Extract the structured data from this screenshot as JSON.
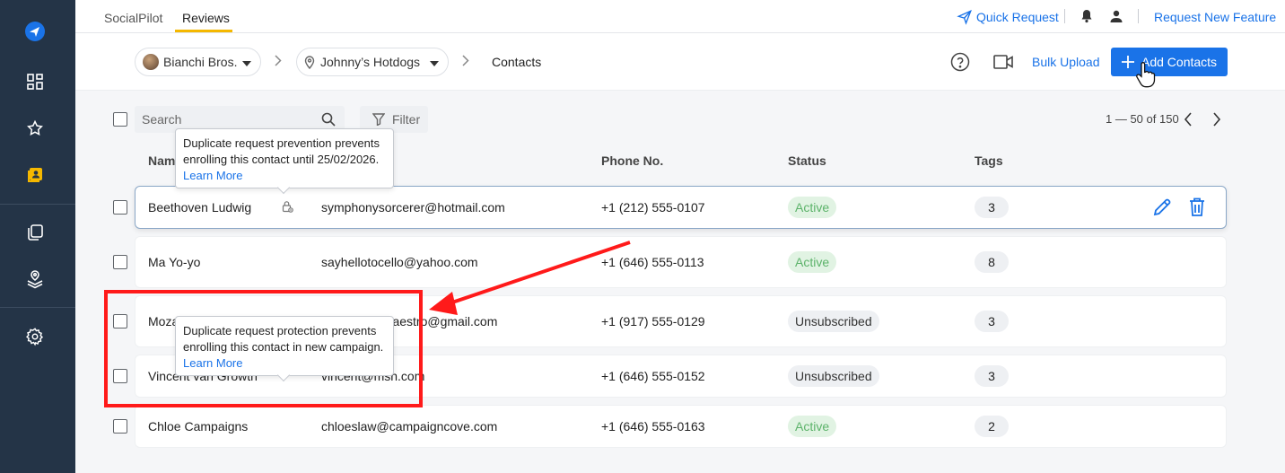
{
  "colors": {
    "accent": "#1a73e8",
    "sidebar": "#243447",
    "tab_underline": "#f5b800",
    "active_badge": "#5cb36a",
    "annotation": "#ff1a1a"
  },
  "sidebar": {
    "items": [
      {
        "icon": "paper-plane-icon"
      },
      {
        "icon": "dashboard-icon"
      },
      {
        "icon": "star-icon"
      },
      {
        "icon": "contacts-icon"
      },
      {
        "icon": "copy-icon"
      },
      {
        "icon": "location-layers-icon"
      },
      {
        "icon": "gear-icon"
      }
    ]
  },
  "topbar": {
    "tabs": [
      {
        "label": "SocialPilot"
      },
      {
        "label": "Reviews"
      }
    ],
    "quick_request": "Quick Request",
    "request_feature": "Request New Feature"
  },
  "breadcrumb": {
    "account": "Bianchi Bros.",
    "location": "Johnny’s Hotdogs",
    "current": "Contacts"
  },
  "toolbar": {
    "bulk_upload": "Bulk Upload",
    "add_contacts": "Add Contacts"
  },
  "list": {
    "search_placeholder": "Search",
    "filter_label": "Filter",
    "pagination": "1 — 50 of 150"
  },
  "columns": {
    "name": "Name",
    "phone": "Phone No.",
    "status": "Status",
    "tags": "Tags"
  },
  "rows": [
    {
      "name": "Beethoven Ludwig",
      "email": "symphonysorcerer@hotmail.com",
      "phone": "+1 (212) 555-0107",
      "status": "Active",
      "tags": "3"
    },
    {
      "name": "Ma Yo-yo",
      "email": "sayhellotocello@yahoo.com",
      "phone": "+1 (646) 555-0113",
      "status": "Active",
      "tags": "8"
    },
    {
      "name": "Moza",
      "email": "gmaestro@gmail.com",
      "phone": "+1 (917) 555-0129",
      "status": "Unsubscribed",
      "tags": "3"
    },
    {
      "name": "Vincent van Growth",
      "email": "vincent@msn.com",
      "phone": "+1 (646) 555-0152",
      "status": "Unsubscribed",
      "tags": "3"
    },
    {
      "name": "Chloe Campaigns",
      "email": "chloeslaw@campaigncove.com",
      "phone": "+1 (646) 555-0163",
      "status": "Active",
      "tags": "2"
    }
  ],
  "tooltips": {
    "top": {
      "text": "Duplicate request prevention prevents enrolling this contact until 25/02/2026.",
      "link": "Learn More"
    },
    "bottom": {
      "text": "Duplicate request protection prevents enrolling this contact in new campaign.",
      "link": "Learn More"
    }
  }
}
